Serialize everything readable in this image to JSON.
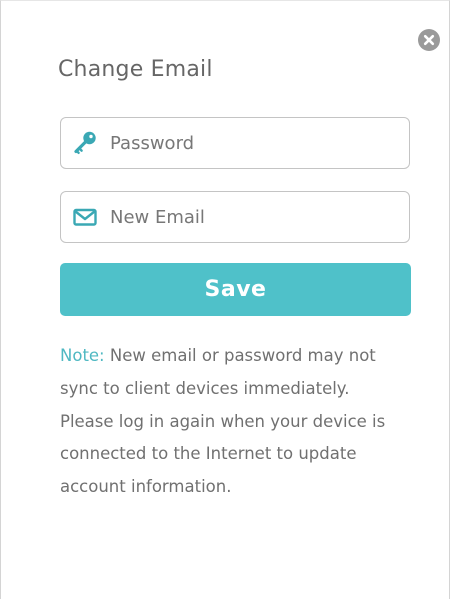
{
  "dialog": {
    "title": "Change Email",
    "close_icon": "close-icon"
  },
  "password_field": {
    "icon": "key-icon",
    "placeholder": "Password",
    "value": ""
  },
  "email_field": {
    "icon": "envelope-icon",
    "placeholder": "New Email",
    "value": ""
  },
  "save_button": {
    "label": "Save"
  },
  "note": {
    "label": "Note:",
    "text": " New email or password may not sync to client devices immediately. Please log in again when your device is connected to the Internet to update account information."
  },
  "colors": {
    "accent": "#4fc1c9",
    "note_label": "#4fb8c2",
    "icon_teal": "#3aa8b4",
    "close_gray": "#9a9a9a",
    "text_gray": "#666666",
    "border_gray": "#c4c4c4"
  }
}
